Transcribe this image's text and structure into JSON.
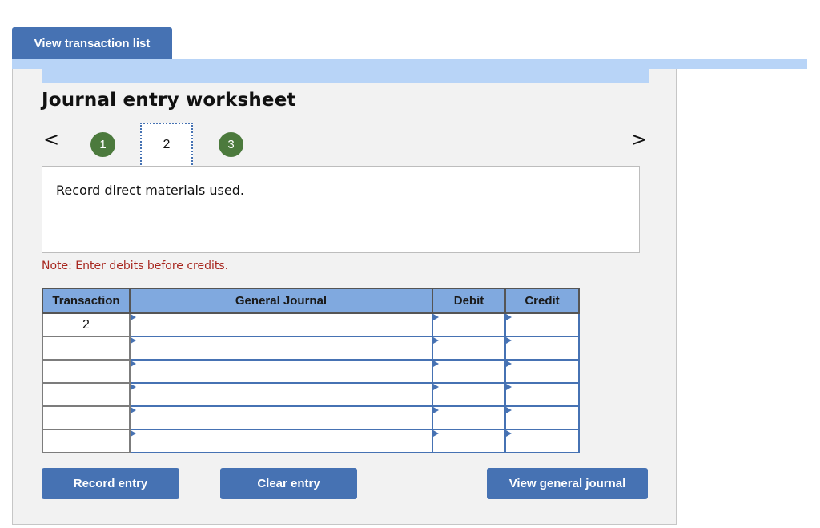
{
  "header": {
    "view_transaction_list": "View transaction list"
  },
  "worksheet": {
    "title": "Journal entry worksheet",
    "nav": {
      "prev_icon": "chevron-left-icon",
      "next_icon": "chevron-right-icon",
      "prev_glyph": "<",
      "next_glyph": ">",
      "steps": [
        {
          "label": "1",
          "state": "completed"
        },
        {
          "label": "2",
          "state": "current"
        },
        {
          "label": "3",
          "state": "completed"
        }
      ]
    },
    "description": "Record direct materials used.",
    "note": "Note: Enter debits before credits.",
    "table": {
      "columns": [
        "Transaction",
        "General Journal",
        "Debit",
        "Credit"
      ],
      "rows": [
        {
          "transaction": "2",
          "account": "",
          "debit": "",
          "credit": ""
        },
        {
          "transaction": "",
          "account": "",
          "debit": "",
          "credit": ""
        },
        {
          "transaction": "",
          "account": "",
          "debit": "",
          "credit": ""
        },
        {
          "transaction": "",
          "account": "",
          "debit": "",
          "credit": ""
        },
        {
          "transaction": "",
          "account": "",
          "debit": "",
          "credit": ""
        },
        {
          "transaction": "",
          "account": "",
          "debit": "",
          "credit": ""
        }
      ]
    },
    "buttons": {
      "record_entry": "Record entry",
      "clear_entry": "Clear entry",
      "view_general_journal": "View general journal"
    }
  },
  "colors": {
    "button": "#4672b3",
    "strip": "#b8d4f7",
    "header_cell": "#80a9df",
    "step_circle": "#4c7a3d",
    "note": "#a8271f",
    "panel": "#f2f2f2"
  }
}
